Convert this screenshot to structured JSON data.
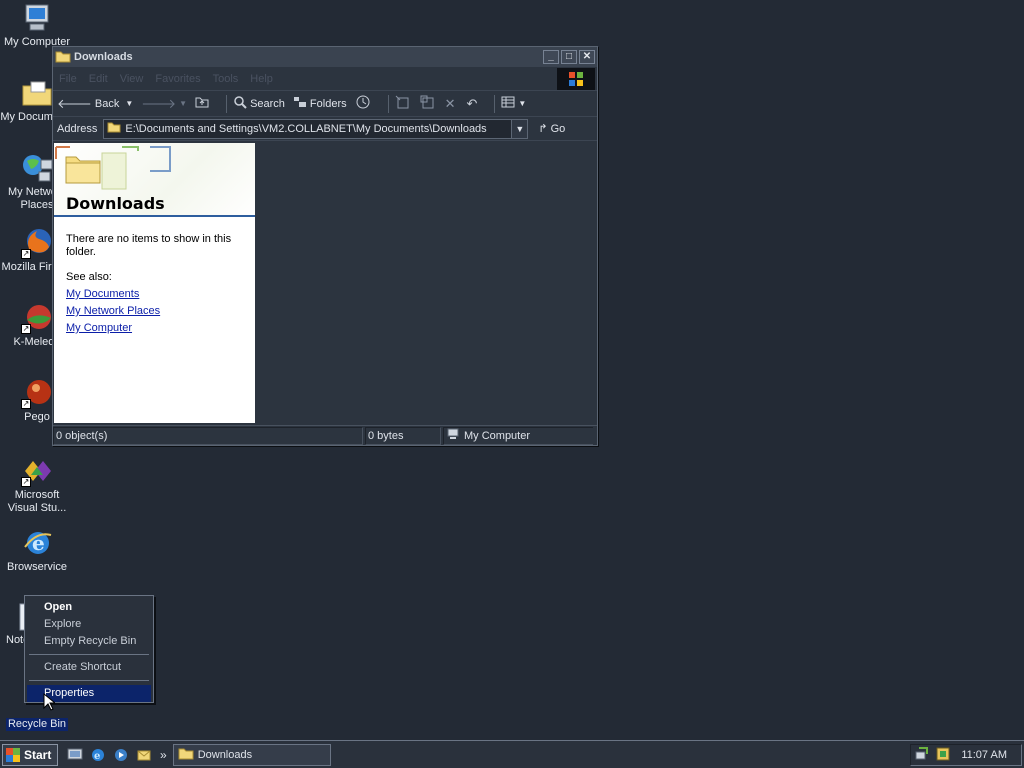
{
  "desktop": {
    "icons": [
      {
        "label": "My Computer",
        "icon": "my-computer-icon"
      },
      {
        "label": "My Documents",
        "icon": "my-documents-icon"
      },
      {
        "label": "My Network Places",
        "icon": "network-places-icon"
      },
      {
        "label": "Mozilla Firefox",
        "icon": "firefox-icon"
      },
      {
        "label": "K-Meleon",
        "icon": "k-meleon-icon"
      },
      {
        "label": "Pego",
        "icon": "pego-icon"
      },
      {
        "label": "Microsoft Visual Stu...",
        "icon": "visual-studio-icon"
      },
      {
        "label": "Browservice",
        "icon": "internet-explorer-icon"
      },
      {
        "label": "Notepad",
        "icon": "notepad-icon"
      },
      {
        "label": "Recycle Bin",
        "icon": "recycle-bin-icon"
      }
    ]
  },
  "window": {
    "title": "Downloads",
    "menu": [
      "File",
      "Edit",
      "View",
      "Favorites",
      "Tools",
      "Help"
    ],
    "toolbar": {
      "back": "Back",
      "search": "Search",
      "folders": "Folders"
    },
    "address": {
      "label": "Address",
      "value": "E:\\Documents and Settings\\VM2.COLLABNET\\My Documents\\Downloads",
      "go": "Go"
    },
    "taskpane": {
      "title": "Downloads",
      "empty_message": "There are no items to show in this folder.",
      "see_also": "See also:",
      "links": [
        "My Documents",
        "My Network Places",
        "My Computer"
      ]
    },
    "status": {
      "objects": "0 object(s)",
      "size": "0 bytes",
      "location": "My Computer"
    }
  },
  "context_menu": {
    "items": [
      "Open",
      "Explore",
      "Empty Recycle Bin",
      "Create Shortcut",
      "Properties"
    ],
    "default_item": "Open",
    "highlighted_item": "Properties"
  },
  "taskbar": {
    "start": "Start",
    "task": "Downloads",
    "clock": "11:07 AM"
  },
  "colors": {
    "desktop": "#232a35",
    "highlight": "#0c246a",
    "link": "#0b1ea8"
  }
}
